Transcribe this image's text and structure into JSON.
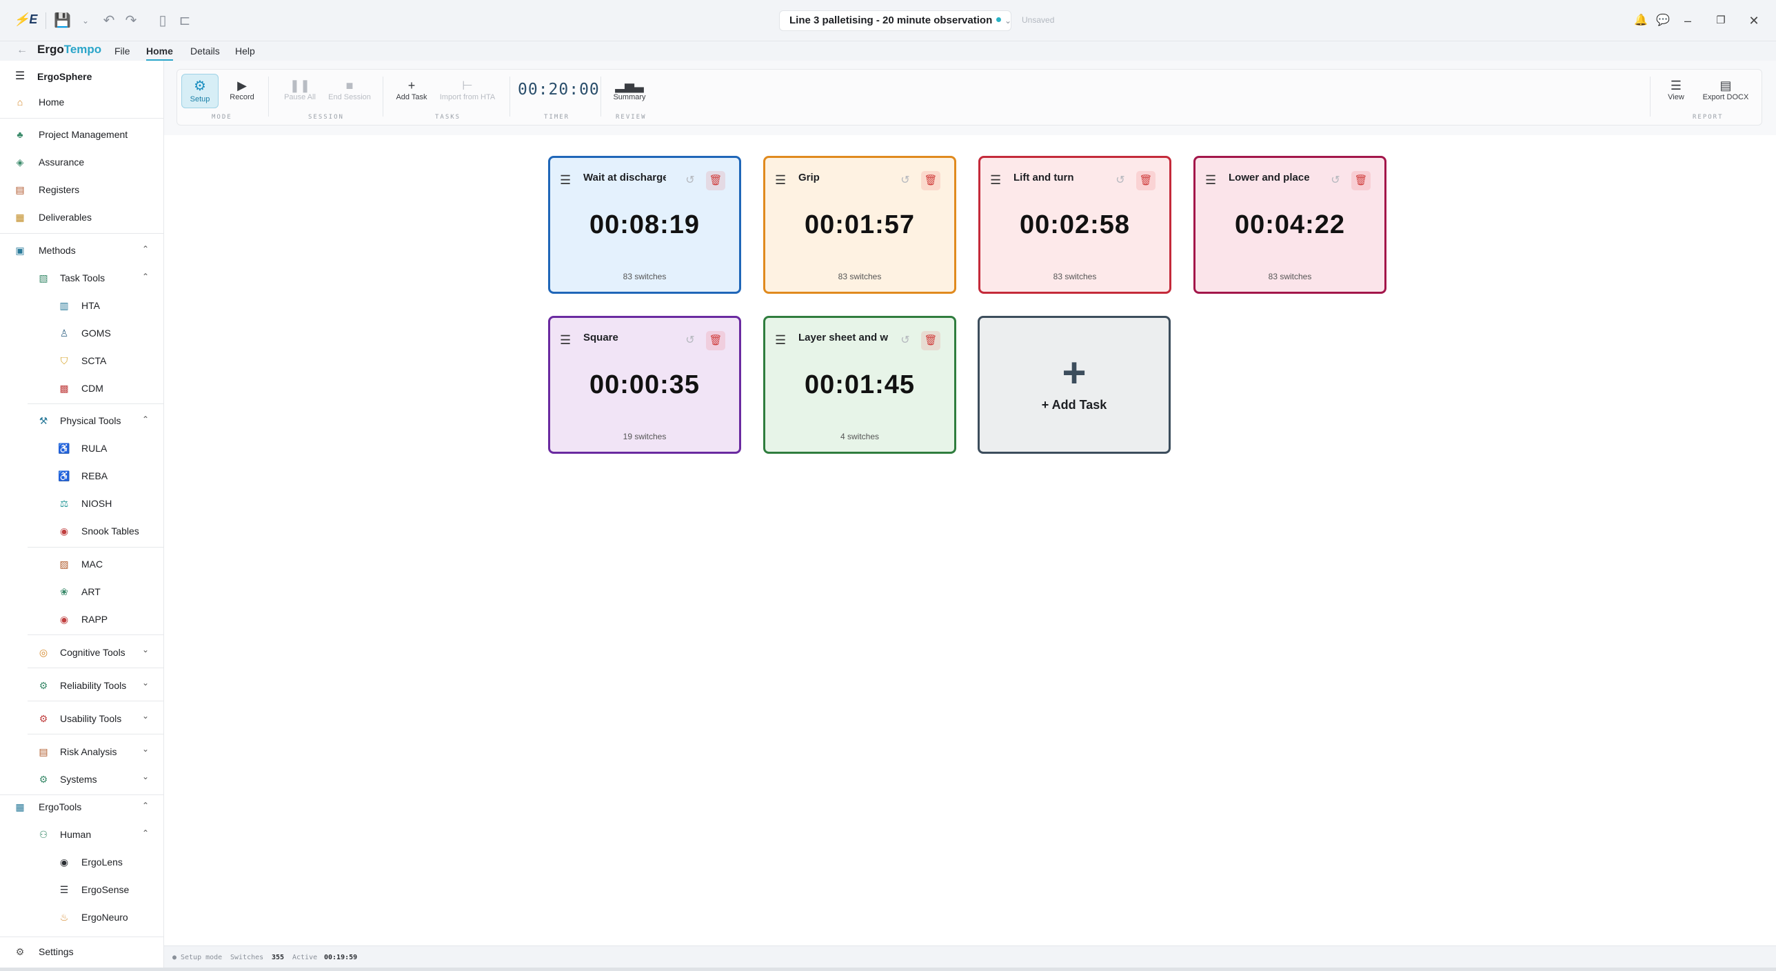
{
  "titlebar": {
    "document_title": "Line 3 palletising - 20 minute observation",
    "save_state": "Unsaved",
    "icons": [
      "app-logo",
      "save-icon",
      "undo-icon",
      "redo-icon",
      "new-file-icon",
      "open-folder-icon",
      "notifications-icon",
      "chat-icon"
    ]
  },
  "menubar": {
    "brand_primary": "Ergo",
    "brand_accent": "Tempo",
    "items": [
      "File",
      "Home",
      "Details",
      "Help"
    ],
    "active": "Home"
  },
  "sidebar": {
    "header": "ErgoSphere",
    "home": "Home",
    "top_items": [
      "Project Management",
      "Assurance",
      "Registers",
      "Deliverables"
    ],
    "methods": "Methods",
    "task_tools": "Task Tools",
    "task_tools_items": [
      "HTA",
      "GOMS",
      "SCTA",
      "CDM"
    ],
    "physical_tools": "Physical Tools",
    "physical_tools_items": [
      "RULA",
      "REBA",
      "NIOSH",
      "Snook Tables"
    ],
    "physical_tools_items_2": [
      "MAC",
      "ART",
      "RAPP"
    ],
    "collapsed_groups": [
      "Cognitive Tools",
      "Reliability Tools",
      "Usability Tools",
      "Risk Analysis",
      "Systems"
    ],
    "ergotools": "ErgoTools",
    "human": "Human",
    "human_items": [
      "ErgoLens",
      "ErgoSense",
      "ErgoNeuro"
    ],
    "settings": "Settings"
  },
  "ribbon": {
    "mode": {
      "setup": "Setup",
      "record": "Record",
      "group": "MODE"
    },
    "session": {
      "pause_all": "Pause All",
      "end_session": "End Session",
      "group": "SESSION"
    },
    "tasks": {
      "add_task": "Add Task",
      "import_hta": "Import from HTA",
      "group": "TASKS"
    },
    "timer": {
      "value": "00:20:00",
      "group": "TIMER"
    },
    "review": {
      "summary": "Summary",
      "group": "REVIEW"
    },
    "report": {
      "view": "View",
      "export": "Export DOCX",
      "group": "REPORT"
    }
  },
  "tasks": [
    {
      "name": "Wait at discharge",
      "time": "00:08:19",
      "switches": "83 switches",
      "border": "#1f66b8",
      "bg": "#e4f1fd"
    },
    {
      "name": "Grip",
      "time": "00:01:57",
      "switches": "83 switches",
      "border": "#e08a1e",
      "bg": "#fef2e2"
    },
    {
      "name": "Lift and turn",
      "time": "00:02:58",
      "switches": "83 switches",
      "border": "#c42a3a",
      "bg": "#fde9ea"
    },
    {
      "name": "Lower and place",
      "time": "00:04:22",
      "switches": "83 switches",
      "border": "#a3164a",
      "bg": "#fbe4ea"
    },
    {
      "name": "Square",
      "time": "00:00:35",
      "switches": "19 switches",
      "border": "#6a2aa0",
      "bg": "#f1e4f6"
    },
    {
      "name": "Layer sheet and wrap",
      "time": "00:01:45",
      "switches": "4 switches",
      "border": "#2f7d3e",
      "bg": "#e7f4e8"
    }
  ],
  "add_task_card": {
    "label": "+ Add Task"
  },
  "statusbar": {
    "mode": "Setup mode",
    "switches_label": "Switches",
    "switches_value": "355",
    "active_label": "Active",
    "active_value": "00:19:59"
  },
  "colors": {
    "accent": "#2aa5c9",
    "add_card_border": "#3c4d5c"
  }
}
